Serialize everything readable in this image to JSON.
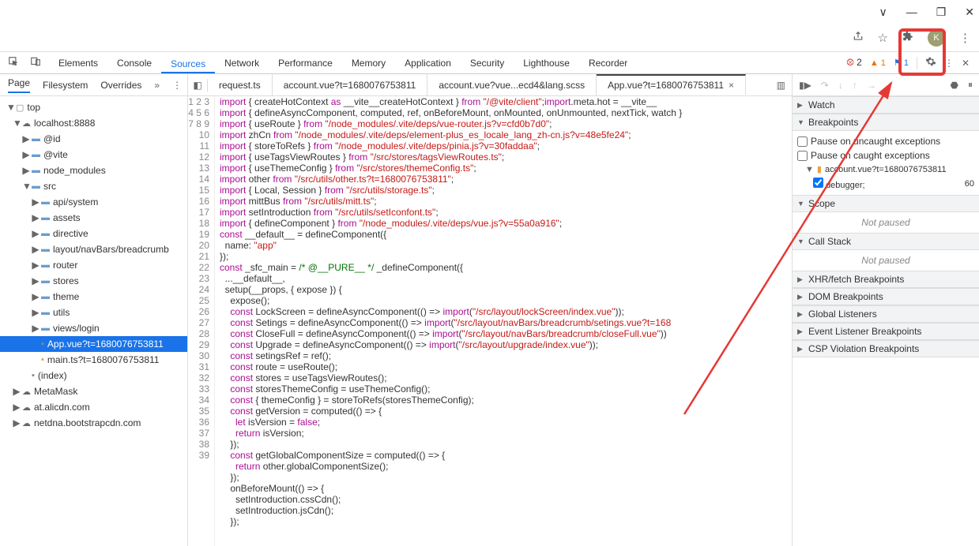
{
  "window_controls": {
    "min": "—",
    "max": "❐",
    "close": "✕",
    "dropdown": "∨"
  },
  "browser_icons": [
    "share-icon",
    "star-icon",
    "puzzle-icon",
    "avatar",
    "menu-icon"
  ],
  "avatar_letter": "K",
  "devtools": {
    "tabs": [
      "Elements",
      "Console",
      "Sources",
      "Network",
      "Performance",
      "Memory",
      "Application",
      "Security",
      "Lighthouse",
      "Recorder"
    ],
    "active_tab": "Sources",
    "errors": "2",
    "warnings": "1",
    "info": "1"
  },
  "sidebar": {
    "tabs": [
      "Page",
      "Filesystem",
      "Overrides"
    ],
    "active": "Page",
    "more": "»",
    "tree": [
      {
        "d": 0,
        "t": "top",
        "ico": "window",
        "exp": true
      },
      {
        "d": 1,
        "t": "localhost:8888",
        "ico": "cloud",
        "exp": true
      },
      {
        "d": 2,
        "t": "@id",
        "ico": "folder"
      },
      {
        "d": 2,
        "t": "@vite",
        "ico": "folder"
      },
      {
        "d": 2,
        "t": "node_modules",
        "ico": "folder"
      },
      {
        "d": 2,
        "t": "src",
        "ico": "folder",
        "exp": true
      },
      {
        "d": 3,
        "t": "api/system",
        "ico": "folder"
      },
      {
        "d": 3,
        "t": "assets",
        "ico": "folder"
      },
      {
        "d": 3,
        "t": "directive",
        "ico": "folder"
      },
      {
        "d": 3,
        "t": "layout/navBars/breadcrumb",
        "ico": "folder"
      },
      {
        "d": 3,
        "t": "router",
        "ico": "folder"
      },
      {
        "d": 3,
        "t": "stores",
        "ico": "folder"
      },
      {
        "d": 3,
        "t": "theme",
        "ico": "folder"
      },
      {
        "d": 3,
        "t": "utils",
        "ico": "folder"
      },
      {
        "d": 3,
        "t": "views/login",
        "ico": "folder"
      },
      {
        "d": 3,
        "t": "App.vue?t=1680076753811",
        "ico": "file",
        "sel": true
      },
      {
        "d": 3,
        "t": "main.ts?t=1680076753811",
        "ico": "file",
        "yellow": true
      },
      {
        "d": 2,
        "t": "(index)",
        "ico": "file"
      },
      {
        "d": 1,
        "t": "MetaMask",
        "ico": "cloud"
      },
      {
        "d": 1,
        "t": "at.alicdn.com",
        "ico": "cloud"
      },
      {
        "d": 1,
        "t": "netdna.bootstrapcdn.com",
        "ico": "cloud"
      }
    ]
  },
  "editor": {
    "tabs": [
      {
        "label": "request.ts"
      },
      {
        "label": "account.vue?t=1680076753811"
      },
      {
        "label": "account.vue?vue...ecd4&lang.scss"
      },
      {
        "label": "App.vue?t=1680076753811",
        "active": true,
        "close": true
      }
    ],
    "code": [
      {
        "n": 1,
        "html": "<span class='k-imp'>import</span> { createHotContext <span class='k-imp'>as</span> __vite__createHotContext } <span class='k-imp'>from</span> <span class='k-str'>\"/@vite/client\"</span>;<span class='k-imp'>import</span>.meta.hot = __vite__"
      },
      {
        "n": 2,
        "html": "<span class='k-imp'>import</span> { defineAsyncComponent, computed, ref, onBeforeMount, onMounted, onUnmounted, nextTick, watch }"
      },
      {
        "n": 3,
        "html": "<span class='k-imp'>import</span> { useRoute } <span class='k-imp'>from</span> <span class='k-str'>\"/node_modules/.vite/deps/vue-router.js?v=cfd0b7d0\"</span>;"
      },
      {
        "n": 4,
        "html": "<span class='k-imp'>import</span> zhCn <span class='k-imp'>from</span> <span class='k-str'>\"/node_modules/.vite/deps/element-plus_es_locale_lang_zh-cn.js?v=48e5fe24\"</span>;"
      },
      {
        "n": 5,
        "html": "<span class='k-imp'>import</span> { storeToRefs } <span class='k-imp'>from</span> <span class='k-str'>\"/node_modules/.vite/deps/pinia.js?v=30faddaa\"</span>;"
      },
      {
        "n": 6,
        "html": "<span class='k-imp'>import</span> { useTagsViewRoutes } <span class='k-imp'>from</span> <span class='k-str'>\"/src/stores/tagsViewRoutes.ts\"</span>;"
      },
      {
        "n": 7,
        "html": "<span class='k-imp'>import</span> { useThemeConfig } <span class='k-imp'>from</span> <span class='k-str'>\"/src/stores/themeConfig.ts\"</span>;"
      },
      {
        "n": 8,
        "html": "<span class='k-imp'>import</span> other <span class='k-imp'>from</span> <span class='k-str'>\"/src/utils/other.ts?t=1680076753811\"</span>;"
      },
      {
        "n": 9,
        "html": "<span class='k-imp'>import</span> { Local, Session } <span class='k-imp'>from</span> <span class='k-str'>\"/src/utils/storage.ts\"</span>;"
      },
      {
        "n": 10,
        "html": "<span class='k-imp'>import</span> mittBus <span class='k-imp'>from</span> <span class='k-str'>\"/src/utils/mitt.ts\"</span>;"
      },
      {
        "n": 11,
        "html": "<span class='k-imp'>import</span> setIntroduction <span class='k-imp'>from</span> <span class='k-str'>\"/src/utils/setIconfont.ts\"</span>;"
      },
      {
        "n": 12,
        "html": "<span class='k-imp'>import</span> { defineComponent } <span class='k-imp'>from</span> <span class='k-str'>\"/node_modules/.vite/deps/vue.js?v=55a0a916\"</span>;"
      },
      {
        "n": 13,
        "html": "<span class='k-key'>const</span> __default__ = defineComponent({"
      },
      {
        "n": 14,
        "html": "  name: <span class='k-str'>\"app\"</span>"
      },
      {
        "n": 15,
        "html": "});"
      },
      {
        "n": 16,
        "html": "<span class='k-key'>const</span> _sfc_main = <span class='k-com'>/* @__PURE__ */</span> _defineComponent({"
      },
      {
        "n": 17,
        "html": "  ...__default__,"
      },
      {
        "n": 18,
        "html": "  setup(__props, { expose }) {"
      },
      {
        "n": 19,
        "html": "    expose();"
      },
      {
        "n": 20,
        "html": "    <span class='k-key'>const</span> LockScreen = defineAsyncComponent(() => <span class='k-imp'>import</span>(<span class='k-str'>\"/src/layout/lockScreen/index.vue\"</span>));"
      },
      {
        "n": 21,
        "html": "    <span class='k-key'>const</span> Setings = defineAsyncComponent(() => <span class='k-imp'>import</span>(<span class='k-str'>\"/src/layout/navBars/breadcrumb/setings.vue?t=168</span>"
      },
      {
        "n": 22,
        "html": "    <span class='k-key'>const</span> CloseFull = defineAsyncComponent(() => <span class='k-imp'>import</span>(<span class='k-str'>\"/src/layout/navBars/breadcrumb/closeFull.vue\"</span>))"
      },
      {
        "n": 23,
        "html": "    <span class='k-key'>const</span> Upgrade = defineAsyncComponent(() => <span class='k-imp'>import</span>(<span class='k-str'>\"/src/layout/upgrade/index.vue\"</span>));"
      },
      {
        "n": 24,
        "html": "    <span class='k-key'>const</span> setingsRef = ref();"
      },
      {
        "n": 25,
        "html": "    <span class='k-key'>const</span> route = useRoute();"
      },
      {
        "n": 26,
        "html": "    <span class='k-key'>const</span> stores = useTagsViewRoutes();"
      },
      {
        "n": 27,
        "html": "    <span class='k-key'>const</span> storesThemeConfig = useThemeConfig();"
      },
      {
        "n": 28,
        "html": "    <span class='k-key'>const</span> { themeConfig } = storeToRefs(storesThemeConfig);"
      },
      {
        "n": 29,
        "html": "    <span class='k-key'>const</span> getVersion = computed(() => {"
      },
      {
        "n": 30,
        "html": "      <span class='k-key'>let</span> isVersion = <span class='k-key'>false</span>;"
      },
      {
        "n": 31,
        "html": "      <span class='k-key'>return</span> isVersion;"
      },
      {
        "n": 32,
        "html": "    });"
      },
      {
        "n": 33,
        "html": "    <span class='k-key'>const</span> getGlobalComponentSize = computed(() => {"
      },
      {
        "n": 34,
        "html": "      <span class='k-key'>return</span> other.globalComponentSize();"
      },
      {
        "n": 35,
        "html": "    });"
      },
      {
        "n": 36,
        "html": "    onBeforeMount(() => {"
      },
      {
        "n": 37,
        "html": "      setIntroduction.cssCdn();"
      },
      {
        "n": 38,
        "html": "      setIntroduction.jsCdn();"
      },
      {
        "n": 39,
        "html": "    });"
      }
    ]
  },
  "right": {
    "watch": "Watch",
    "breakpoints": "Breakpoints",
    "pause_uncaught": "Pause on uncaught exceptions",
    "pause_caught": "Pause on caught exceptions",
    "bp_file": "account.vue?t=1680076753811",
    "bp_code": "debugger;",
    "bp_line": "60",
    "scope": "Scope",
    "not_paused": "Not paused",
    "callstack": "Call Stack",
    "xhr": "XHR/fetch Breakpoints",
    "dom": "DOM Breakpoints",
    "global": "Global Listeners",
    "event": "Event Listener Breakpoints",
    "csp": "CSP Violation Breakpoints"
  }
}
